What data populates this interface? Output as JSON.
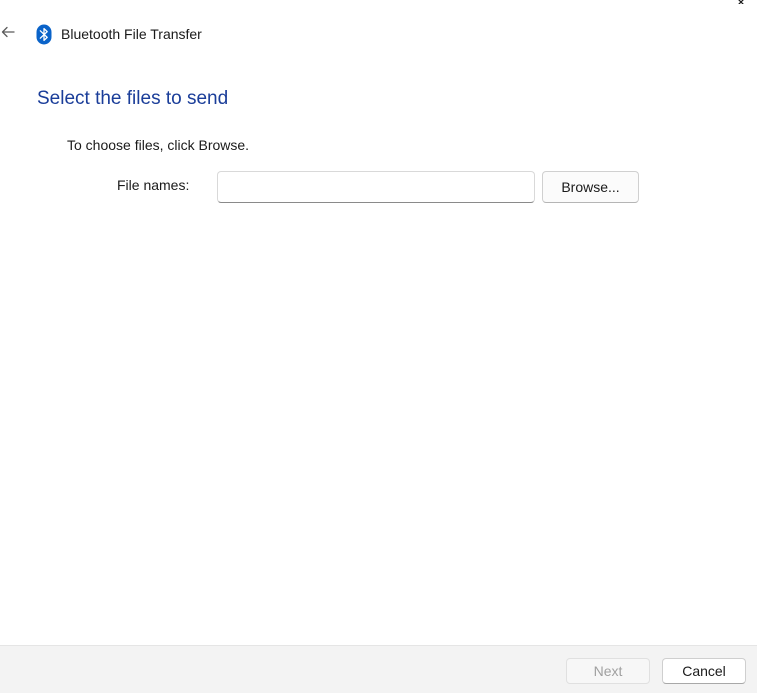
{
  "window": {
    "title": "Bluetooth File Transfer",
    "close_icon": "close-icon"
  },
  "header": {
    "back_icon": "back-arrow-icon",
    "app_icon": "bluetooth-icon",
    "app_title": "Bluetooth File Transfer"
  },
  "main": {
    "heading": "Select the files to send",
    "instructions": "To choose files, click Browse.",
    "file_names_label": "File names:",
    "file_names_value": "",
    "browse_label": "Browse..."
  },
  "footer": {
    "next_label": "Next",
    "next_enabled": false,
    "cancel_label": "Cancel"
  },
  "colors": {
    "heading": "#1a3d99",
    "bluetooth_badge": "#0a63c9",
    "footer_bg": "#f3f3f3",
    "disabled_text": "#a0a0a0"
  }
}
